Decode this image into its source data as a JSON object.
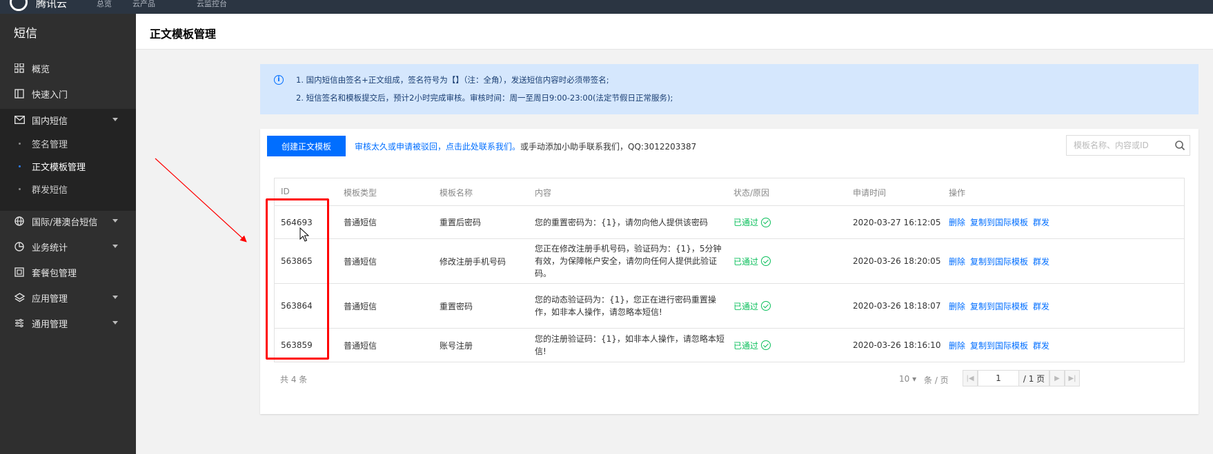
{
  "topbar": {
    "brand": "腾讯云",
    "items": [
      "总览",
      "云产品",
      "云监控台"
    ]
  },
  "sidebar": {
    "title": "短信",
    "items": [
      {
        "label": "概览",
        "icon": "grid-icon"
      },
      {
        "label": "快速入门",
        "icon": "book-icon"
      },
      {
        "label": "国内短信",
        "icon": "mail-icon"
      },
      {
        "label": "国际/港澳台短信",
        "icon": "globe-icon"
      },
      {
        "label": "业务统计",
        "icon": "pie-chart-icon"
      },
      {
        "label": "套餐包管理",
        "icon": "package-icon"
      },
      {
        "label": "应用管理",
        "icon": "layers-icon"
      },
      {
        "label": "通用管理",
        "icon": "sliders-icon"
      }
    ],
    "sub_items": [
      {
        "label": "签名管理"
      },
      {
        "label": "正文模板管理"
      },
      {
        "label": "群发短信"
      }
    ]
  },
  "header": {
    "title": "正文模板管理"
  },
  "notice": {
    "line1": "1. 国内短信由签名+正文组成，签名符号为【】（注：全角），发送短信内容时必须带签名;",
    "line2": "2. 短信签名和模板提交后，预计2小时完成审核。审核时间：周一至周日9:00-23:00(法定节假日正常服务);"
  },
  "toolbar": {
    "create_label": "创建正文模板",
    "tip_link": "审核太久或申请被驳回，点击此处联系我们。",
    "tip_text": "或手动添加小助手联系我们，QQ:3012203387",
    "search_placeholder": "模板名称、内容或ID"
  },
  "table": {
    "columns": [
      "ID",
      "模板类型",
      "模板名称",
      "内容",
      "状态/原因",
      "申请时间",
      "操作"
    ],
    "rows": [
      {
        "id": "564693",
        "type": "普通短信",
        "name": "重置后密码",
        "content": "您的重置密码为：{1}，请勿向他人提供该密码",
        "status": "已通过",
        "time": "2020-03-27 16:12:05"
      },
      {
        "id": "563865",
        "type": "普通短信",
        "name": "修改注册手机号码",
        "content": "您正在修改注册手机号码，验证码为：{1}，5分钟有效，为保障帐户安全，请勿向任何人提供此验证码。",
        "status": "已通过",
        "time": "2020-03-26 18:20:05"
      },
      {
        "id": "563864",
        "type": "普通短信",
        "name": "重置密码",
        "content": "您的动态验证码为：{1}，您正在进行密码重置操作，如非本人操作，请忽略本短信!",
        "status": "已通过",
        "time": "2020-03-26 18:18:07"
      },
      {
        "id": "563859",
        "type": "普通短信",
        "name": "账号注册",
        "content": "您的注册验证码：{1}，如非本人操作，请忽略本短信!",
        "status": "已通过",
        "time": "2020-03-26 18:16:10"
      }
    ],
    "actions": [
      "删除",
      "复制到国际模板",
      "群发"
    ]
  },
  "footer": {
    "total": "共 4 条",
    "page_size": "10 ▾",
    "per_page": "条 / 页",
    "page_value": "1",
    "page_total": "/ 1 页"
  }
}
